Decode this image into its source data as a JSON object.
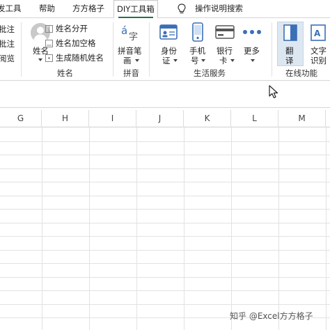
{
  "tabs": [
    {
      "label": "发工具",
      "active": false
    },
    {
      "label": "帮助",
      "active": false
    },
    {
      "label": "方方格子",
      "active": false
    },
    {
      "label": "DIY工具箱",
      "active": true
    },
    {
      "label": "操作说明搜索",
      "active": false
    }
  ],
  "ribbon": {
    "left_partial": [
      "批注",
      "批注",
      "阅览"
    ],
    "name_group": {
      "big_button": "姓名",
      "items": [
        "姓名分开",
        "姓名加空格",
        "生成随机姓名"
      ],
      "label": "姓名"
    },
    "pinyin_group": {
      "button_line1": "拼音笔",
      "button_line2": "画",
      "label": "拼音"
    },
    "life_group": {
      "buttons": [
        {
          "line1": "身份",
          "line2": "证",
          "icon": "id-card-icon"
        },
        {
          "line1": "手机",
          "line2": "号",
          "icon": "mobile-phone-icon"
        },
        {
          "line1": "银行",
          "line2": "卡",
          "icon": "bank-card-icon"
        },
        {
          "line1": "更多",
          "line2": "",
          "icon": "more-dots-icon"
        }
      ],
      "label": "生活服务"
    },
    "online_group": {
      "buttons": [
        {
          "line1": "翻",
          "line2": "译",
          "icon": "translate-icon"
        },
        {
          "line1": "文字",
          "line2": "识别",
          "icon": "text-recognition-icon"
        }
      ],
      "label": "在线功能"
    }
  },
  "columns": [
    "G",
    "H",
    "I",
    "J",
    "K",
    "L",
    "M"
  ],
  "watermark": "知乎 @Excel方方格子",
  "colors": {
    "accent": "#217346",
    "icon_blue": "#3b6fb6",
    "grid": "#e2e2e2"
  }
}
